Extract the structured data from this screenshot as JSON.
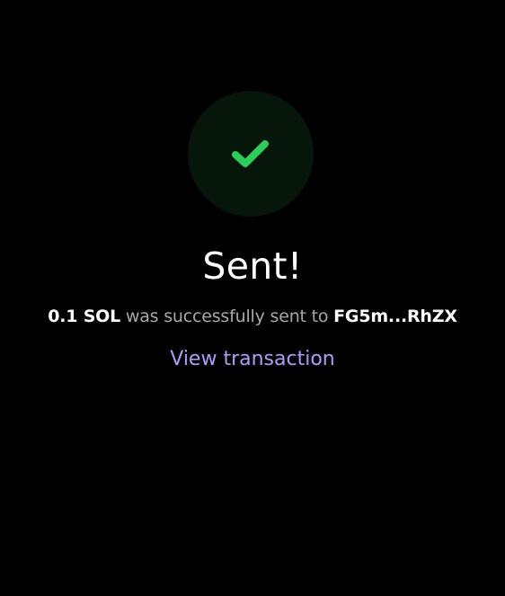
{
  "status": {
    "icon": "checkmark-icon",
    "title": "Sent!"
  },
  "message": {
    "amount": "0.1 SOL",
    "text": " was successfully sent to ",
    "recipient": "FG5m...RhZX"
  },
  "actions": {
    "view_transaction": "View transaction"
  },
  "colors": {
    "background": "#000000",
    "check_circle_bg": "#07160b",
    "check_green": "#2ecc5a",
    "link_purple": "#ab9ff2",
    "muted_text": "#a8a8a8"
  }
}
